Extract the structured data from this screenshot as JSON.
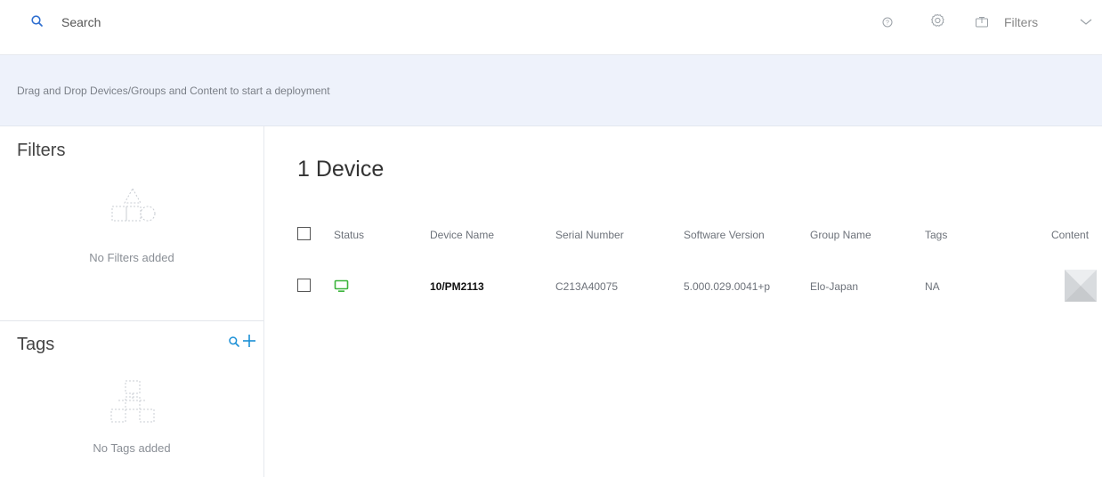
{
  "topbar": {
    "search_label": "Search",
    "filters_label": "Filters",
    "icons": [
      "search-icon",
      "help-icon",
      "gear-icon",
      "filter-toggle-icon",
      "chevron-down-icon"
    ]
  },
  "dropbar": {
    "message": "Drag and Drop Devices/Groups and Content to start a deployment"
  },
  "sidebar": {
    "filters_title": "Filters",
    "filters_empty": "No Filters added",
    "tags_title": "Tags",
    "tags_empty": "No Tags added"
  },
  "main": {
    "device_count_label": "1 Device",
    "columns": [
      "Status",
      "Device Name",
      "Serial Number",
      "Software Version",
      "Group Name",
      "Tags",
      "Content"
    ],
    "rows": [
      {
        "status_icon": "monitor-icon",
        "status_color": "#3cb43c",
        "device_name": "10/PM2113",
        "serial_number": "C213A40075",
        "software_version": "5.000.029.0041+p",
        "group_name": "Elo-Japan",
        "tags": "NA",
        "content_icon": "content-thumbnail"
      }
    ]
  },
  "colors": {
    "accent": "#1a8fd6",
    "banner_bg": "#eef2fb",
    "status_online": "#3cb43c"
  }
}
